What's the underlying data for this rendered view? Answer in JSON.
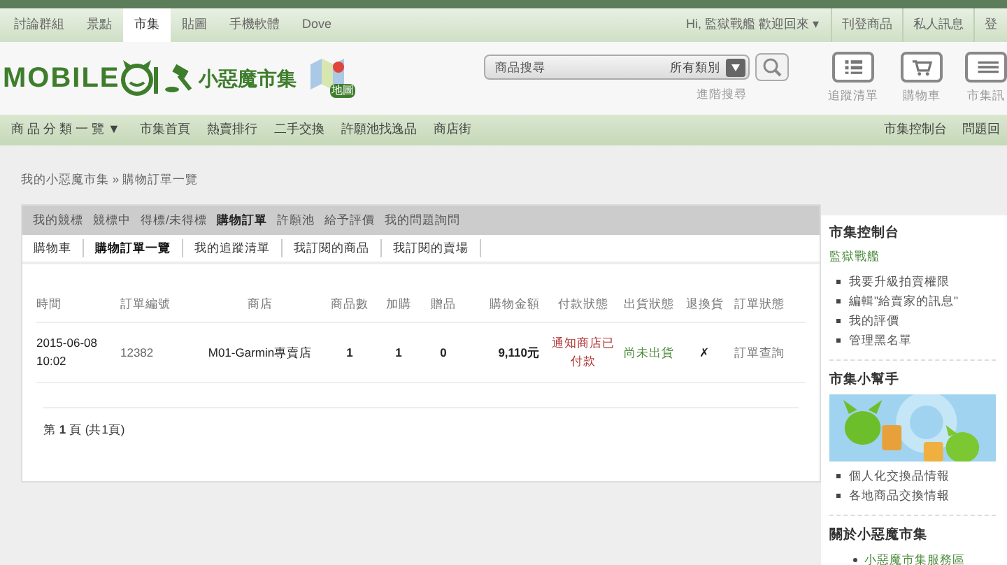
{
  "top_tabs": [
    {
      "label": "討論群組",
      "selected": false
    },
    {
      "label": "景點",
      "selected": false
    },
    {
      "label": "市集",
      "selected": true
    },
    {
      "label": "貼圖",
      "selected": false
    },
    {
      "label": "手機軟體",
      "selected": false
    },
    {
      "label": "Dove",
      "selected": false
    }
  ],
  "user_menu": {
    "greeting": "Hi, 監獄戰艦 歡迎回來 ▾",
    "links": [
      "刊登商品",
      "私人訊息",
      "登"
    ]
  },
  "logo": {
    "wordmark": "MOBILE",
    "market": "小惡魔市集",
    "map": "地圖"
  },
  "search": {
    "placeholder": "商品搜尋",
    "category": "所有類別",
    "advanced": "進階搜尋"
  },
  "shortcuts": [
    {
      "kind": "list",
      "label": "追蹤清單"
    },
    {
      "kind": "cart",
      "label": "購物車"
    },
    {
      "kind": "message",
      "label": "市集訊"
    }
  ],
  "nav": {
    "category_menu": "商 品 分 類 一 覽 ▼",
    "items": [
      "市集首頁",
      "熱賣排行",
      "二手交換",
      "許願池找逸品",
      "商店街"
    ],
    "right_items": [
      "市集控制台",
      "問題回"
    ]
  },
  "breadcrumb": "我的小惡魔市集 » 購物訂單一覽",
  "main_tabs": [
    {
      "label": "我的競標",
      "selected": false
    },
    {
      "label": "競標中",
      "selected": false
    },
    {
      "label": "得標/未得標",
      "selected": false
    },
    {
      "label": "購物訂單",
      "selected": true
    },
    {
      "label": "許願池",
      "selected": false
    },
    {
      "label": "給予評價",
      "selected": false
    },
    {
      "label": "我的問題詢問",
      "selected": false
    }
  ],
  "sub_tabs": [
    {
      "label": "購物車",
      "selected": false
    },
    {
      "label": "購物訂單一覽",
      "selected": true
    },
    {
      "label": "我的追蹤清單",
      "selected": false
    },
    {
      "label": "我訂閱的商品",
      "selected": false
    },
    {
      "label": "我訂閱的賣場",
      "selected": false
    }
  ],
  "table": {
    "columns": [
      "時間",
      "訂單編號",
      "商店",
      "商品數",
      "加購",
      "贈品",
      "購物金額",
      "付款狀態",
      "出貨狀態",
      "退換貨",
      "訂單狀態"
    ],
    "rows": [
      {
        "time": "2015-06-08 10:02",
        "order_no": "12382",
        "store": "M01-Garmin專賣店",
        "items": "1",
        "addons": "1",
        "gifts": "0",
        "amount": "9,110元",
        "payment": "通知商店已付款",
        "shipping": "尚未出貨",
        "return": "✗",
        "status": "訂單查詢"
      }
    ]
  },
  "pagination": "第 **1** 頁 (共1頁)",
  "sidebar": {
    "sections": [
      {
        "title": "市集控制台",
        "subtitle": "監獄戰艦",
        "items": [
          "我要升級拍賣權限",
          "編輯\"給賣家的訊息\"",
          "我的評價",
          "管理黑名單"
        ]
      },
      {
        "title": "市集小幫手",
        "banner": {
          "kind": "picture"
        },
        "items": [
          "個人化交換品情報",
          "各地商品交換情報"
        ]
      },
      {
        "title": "關於小惡魔市集",
        "link_items": [
          "小惡魔市集服務區"
        ]
      }
    ]
  }
}
